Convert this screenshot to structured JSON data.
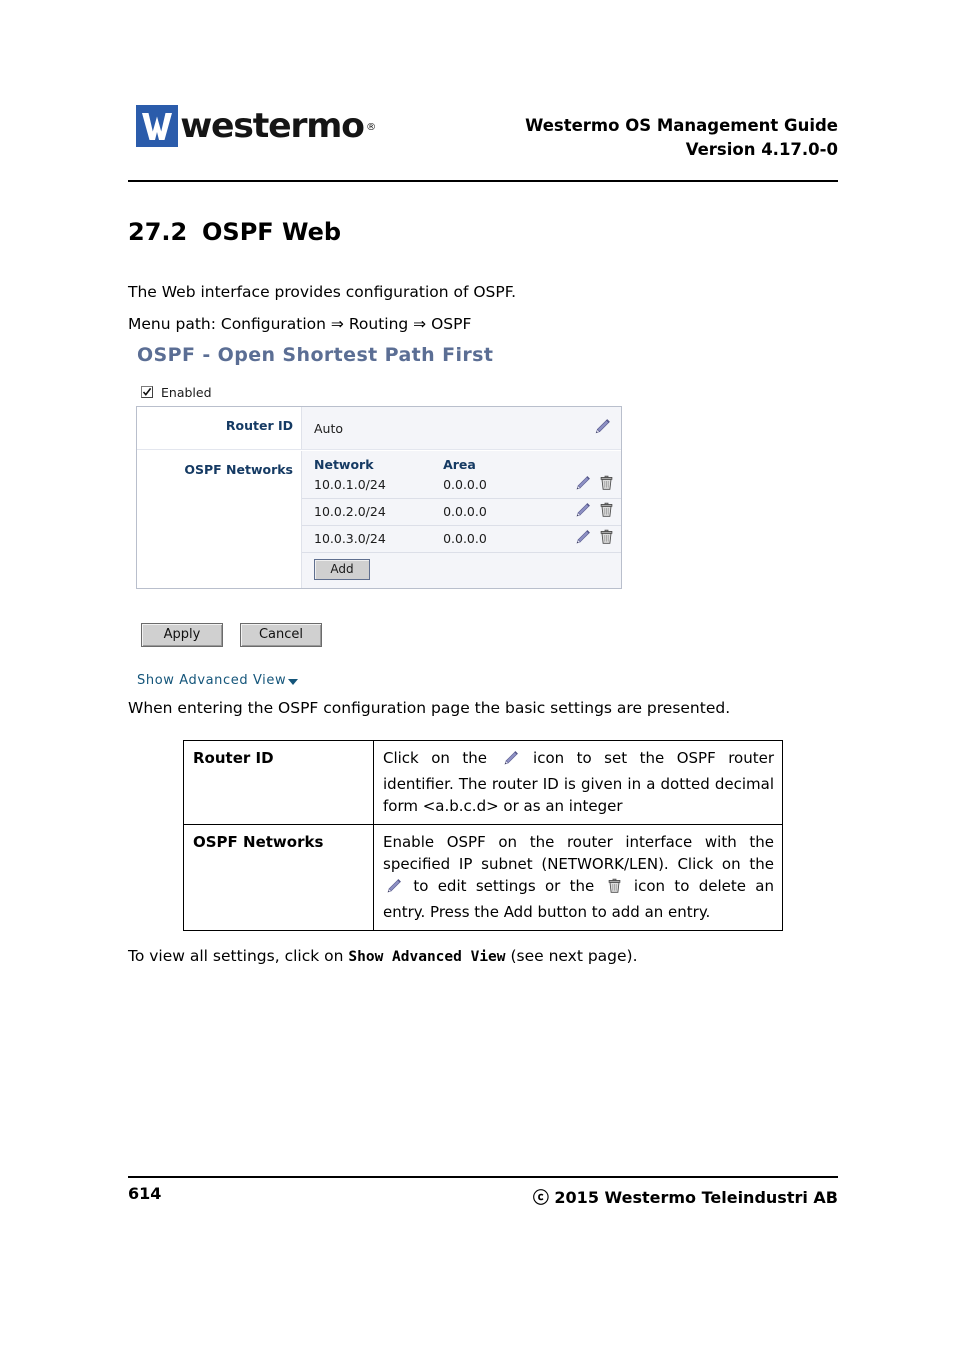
{
  "header": {
    "logo_text": "westermo",
    "logo_reg": "®",
    "title_line1": "Westermo OS Management Guide",
    "title_line2": "Version 4.17.0-0"
  },
  "section": {
    "number": "27.2",
    "title": "OSPF Web",
    "intro": "The Web interface provides configuration of OSPF.",
    "menu_path": "Menu path: Configuration ⇒ Routing ⇒ OSPF"
  },
  "webui": {
    "panel_title": "OSPF - Open Shortest Path First",
    "enabled_label": "Enabled",
    "router_id_label": "Router ID",
    "router_id_value": "Auto",
    "networks_label": "OSPF Networks",
    "columns": [
      "Network",
      "Area"
    ],
    "rows": [
      {
        "network": "10.0.1.0/24",
        "area": "0.0.0.0"
      },
      {
        "network": "10.0.2.0/24",
        "area": "0.0.0.0"
      },
      {
        "network": "10.0.3.0/24",
        "area": "0.0.0.0"
      }
    ],
    "add_label": "Add",
    "apply_label": "Apply",
    "cancel_label": "Cancel",
    "advanced_link": "Show Advanced View",
    "icons": {
      "edit": "pencil-icon",
      "delete": "trash-icon",
      "caret": "caret-down-icon"
    },
    "colors": {
      "panel_title": "#5b6e94",
      "field_label": "#153a63",
      "link": "#14557a",
      "logo_blue": "#2b5cab"
    }
  },
  "body": {
    "para_when": "When entering the OSPF configuration page the basic settings are presented.",
    "to_view_prefix": "To view all settings, click on ",
    "to_view_mono": "Show Advanced View",
    "to_view_suffix": " (see next page)."
  },
  "desc_table": {
    "rows": [
      {
        "key": "Router ID",
        "value_part1": "Click on the ",
        "value_part2": " icon to set the OSPF router identifier. The router ID is given in a dotted decimal form <a.b.c.d> or as an integer"
      },
      {
        "key": "OSPF Networks",
        "value_part1": "Enable OSPF on the router interface with the specified IP subnet (NETWORK/LEN). Click on the ",
        "value_part2": " to edit settings or the ",
        "value_part3": " icon to delete an entry. Press the Add button to add an entry."
      }
    ]
  },
  "footer": {
    "page_number": "614",
    "copyright": "ⓒ 2015 Westermo Teleindustri AB"
  }
}
